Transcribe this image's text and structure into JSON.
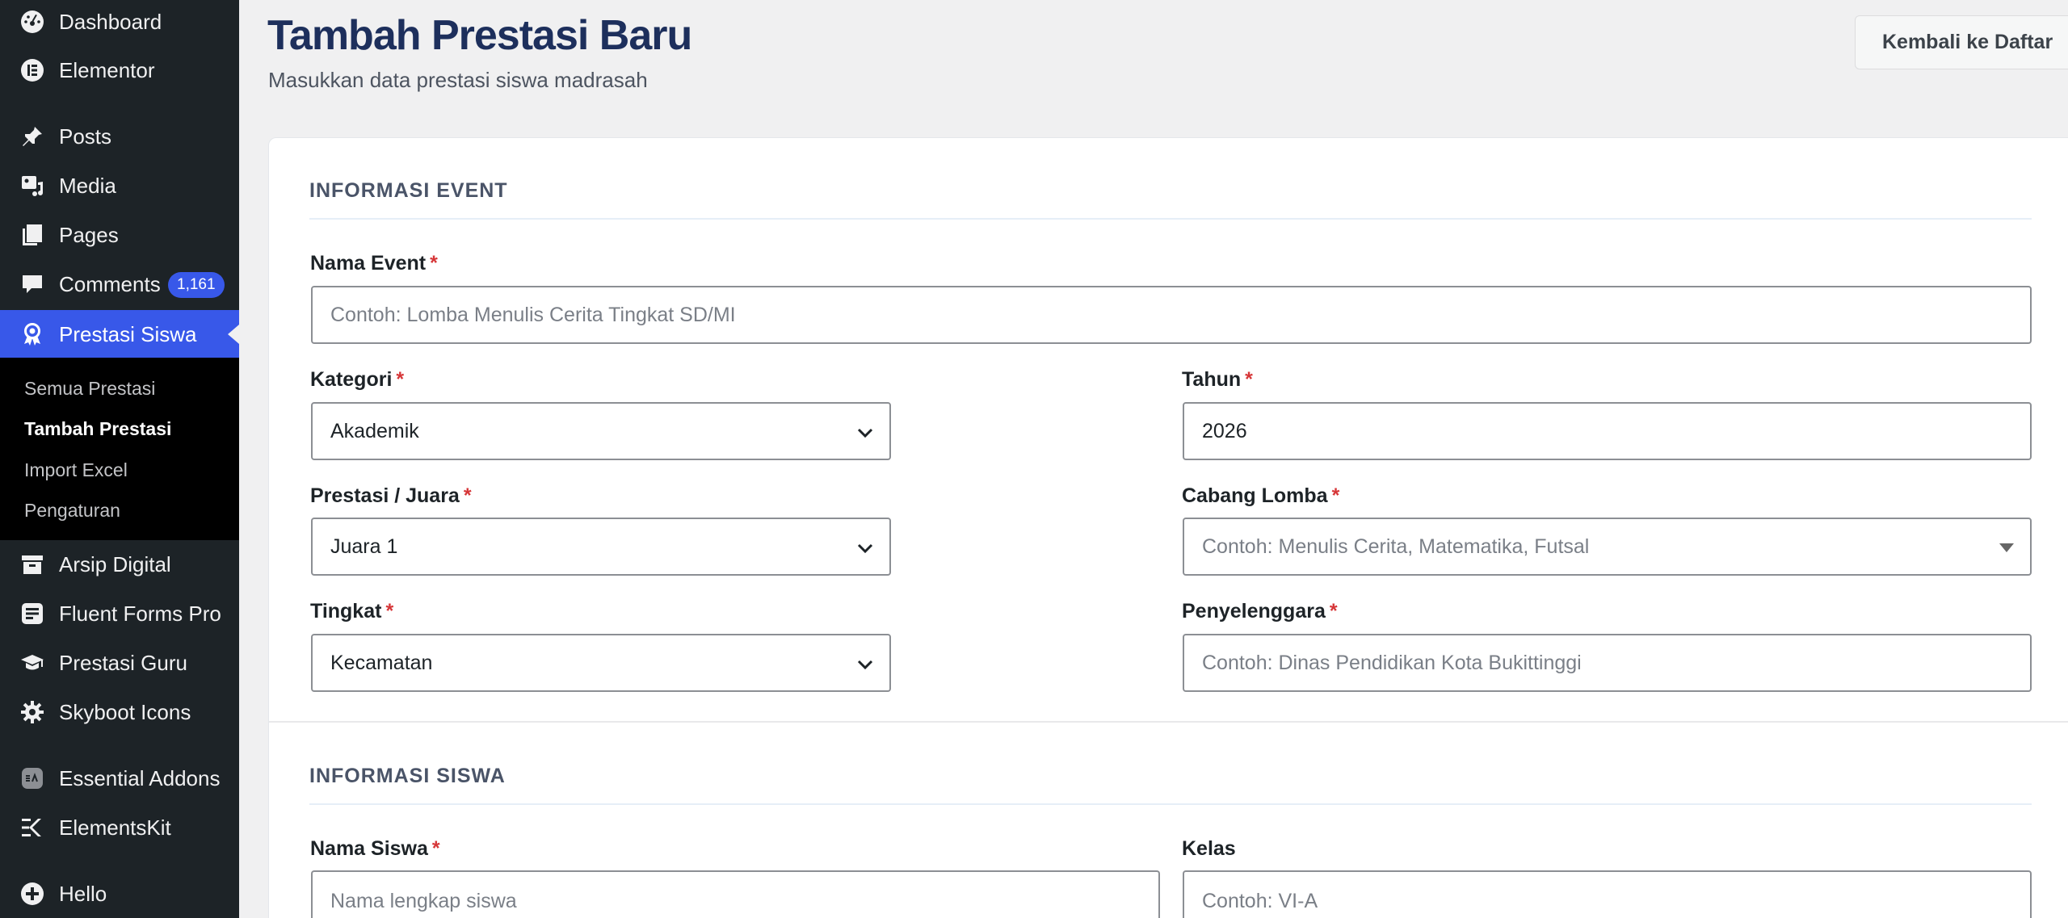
{
  "sidebar": {
    "items": [
      {
        "label": "Dashboard",
        "icon": "dashboard-icon"
      },
      {
        "label": "Elementor",
        "icon": "elementor-icon"
      },
      {
        "label": "Posts",
        "icon": "pushpin-icon"
      },
      {
        "label": "Media",
        "icon": "media-icon"
      },
      {
        "label": "Pages",
        "icon": "pages-icon"
      },
      {
        "label": "Comments",
        "icon": "comment-icon",
        "badge": "1,161"
      },
      {
        "label": "Prestasi Siswa",
        "icon": "award-icon",
        "active": true
      },
      {
        "label": "Arsip Digital",
        "icon": "archive-icon"
      },
      {
        "label": "Fluent Forms Pro",
        "icon": "fluent-forms-icon"
      },
      {
        "label": "Prestasi Guru",
        "icon": "graduation-cap-icon"
      },
      {
        "label": "Skyboot Icons",
        "icon": "gear-icon"
      },
      {
        "label": "Essential Addons",
        "icon": "essential-addons-icon"
      },
      {
        "label": "ElementsKit",
        "icon": "elementskit-icon"
      },
      {
        "label": "Hello",
        "icon": "plus-circle-icon"
      }
    ],
    "submenu": [
      {
        "label": "Semua Prestasi"
      },
      {
        "label": "Tambah Prestasi",
        "current": true
      },
      {
        "label": "Import Excel"
      },
      {
        "label": "Pengaturan"
      }
    ]
  },
  "header": {
    "title": "Tambah Prestasi Baru",
    "subtitle": "Masukkan data prestasi siswa madrasah",
    "back_button": "Kembali ke Daftar"
  },
  "event_section": {
    "title": "INFORMASI EVENT",
    "nama_event": {
      "label": "Nama Event",
      "required": "*",
      "placeholder": "Contoh: Lomba Menulis Cerita Tingkat SD/MI"
    },
    "kategori": {
      "label": "Kategori",
      "required": "*",
      "value": "Akademik"
    },
    "tahun": {
      "label": "Tahun",
      "required": "*",
      "value": "2026"
    },
    "prestasi": {
      "label": "Prestasi / Juara",
      "required": "*",
      "value": "Juara 1"
    },
    "cabang": {
      "label": "Cabang Lomba",
      "required": "*",
      "placeholder": "Contoh: Menulis Cerita, Matematika, Futsal"
    },
    "tingkat": {
      "label": "Tingkat",
      "required": "*",
      "value": "Kecamatan"
    },
    "penyelenggara": {
      "label": "Penyelenggara",
      "required": "*",
      "placeholder": "Contoh: Dinas Pendidikan Kota Bukittinggi"
    }
  },
  "siswa_section": {
    "title": "INFORMASI SISWA",
    "nama_siswa": {
      "label": "Nama Siswa",
      "required": "*",
      "placeholder": "Nama lengkap siswa"
    },
    "kelas": {
      "label": "Kelas",
      "placeholder": "Contoh: VI-A"
    }
  },
  "colors": {
    "sidebar_bg": "#1d2327",
    "accent": "#3858e9",
    "title": "#1d2f5c",
    "required": "#d63638"
  }
}
